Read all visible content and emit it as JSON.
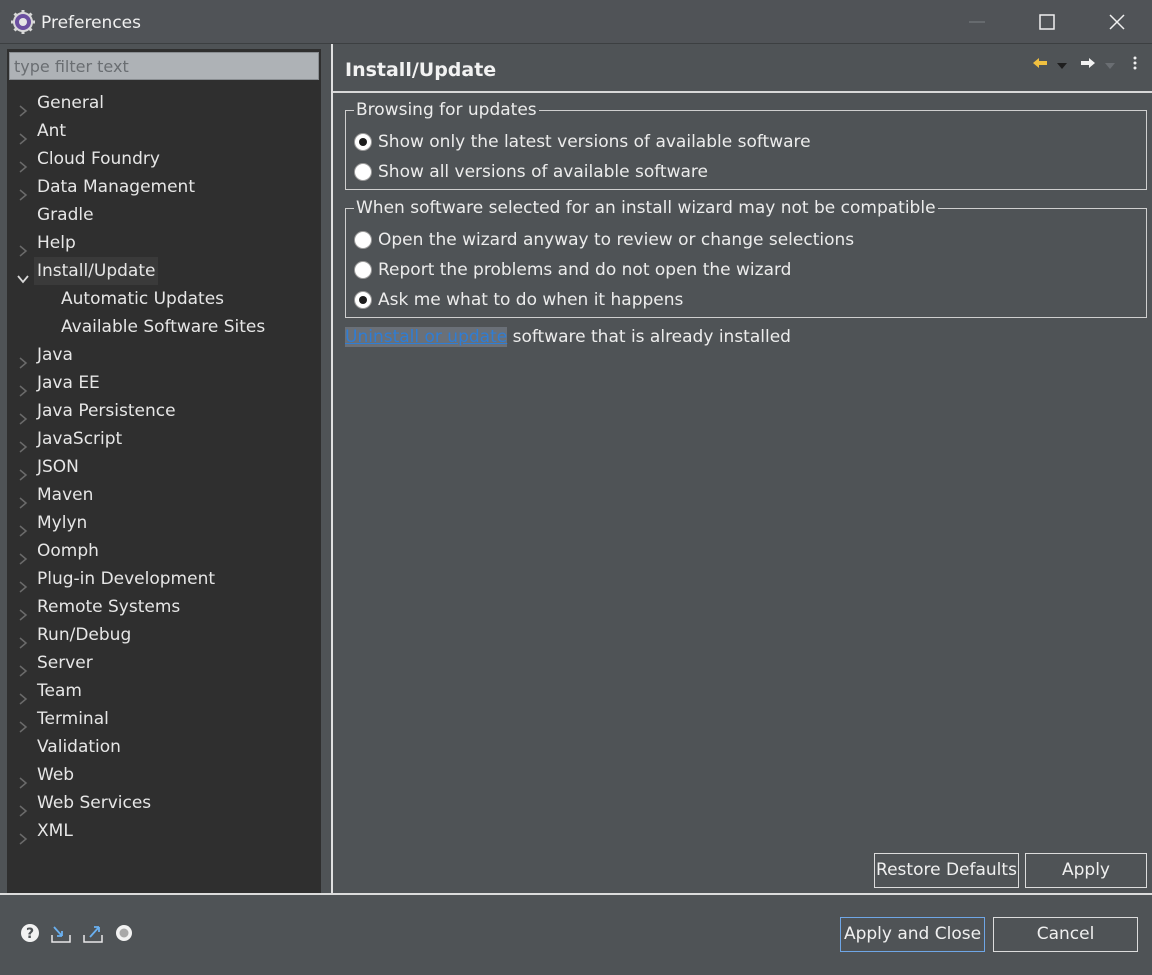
{
  "window": {
    "title": "Preferences"
  },
  "filter": {
    "placeholder": "type filter text"
  },
  "tree": {
    "items": [
      {
        "label": "General",
        "expandable": true
      },
      {
        "label": "Ant",
        "expandable": true
      },
      {
        "label": "Cloud Foundry",
        "expandable": true
      },
      {
        "label": "Data Management",
        "expandable": true
      },
      {
        "label": "Gradle",
        "expandable": false
      },
      {
        "label": "Help",
        "expandable": true
      },
      {
        "label": "Install/Update",
        "expandable": true,
        "expanded": true,
        "selected": true
      },
      {
        "label": "Automatic Updates",
        "child": true
      },
      {
        "label": "Available Software Sites",
        "child": true
      },
      {
        "label": "Java",
        "expandable": true
      },
      {
        "label": "Java EE",
        "expandable": true
      },
      {
        "label": "Java Persistence",
        "expandable": true
      },
      {
        "label": "JavaScript",
        "expandable": true
      },
      {
        "label": "JSON",
        "expandable": true
      },
      {
        "label": "Maven",
        "expandable": true
      },
      {
        "label": "Mylyn",
        "expandable": true
      },
      {
        "label": "Oomph",
        "expandable": true
      },
      {
        "label": "Plug-in Development",
        "expandable": true
      },
      {
        "label": "Remote Systems",
        "expandable": true
      },
      {
        "label": "Run/Debug",
        "expandable": true
      },
      {
        "label": "Server",
        "expandable": true
      },
      {
        "label": "Team",
        "expandable": true
      },
      {
        "label": "Terminal",
        "expandable": true
      },
      {
        "label": "Validation",
        "expandable": false
      },
      {
        "label": "Web",
        "expandable": true
      },
      {
        "label": "Web Services",
        "expandable": true
      },
      {
        "label": "XML",
        "expandable": true
      }
    ]
  },
  "page": {
    "title": "Install/Update",
    "browsing_group": {
      "legend": "Browsing for updates",
      "options": [
        {
          "label": "Show only the latest versions of available software",
          "checked": true
        },
        {
          "label": "Show all versions of available software",
          "checked": false
        }
      ]
    },
    "compat_group": {
      "legend": "When software selected for an install wizard may not be compatible",
      "options": [
        {
          "label": "Open the wizard anyway to review or change selections",
          "checked": false
        },
        {
          "label": "Report the problems and do not open the wizard",
          "checked": false
        },
        {
          "label": "Ask me what to do when it happens",
          "checked": true
        }
      ]
    },
    "link_text": "Uninstall or update",
    "link_suffix": " software that is already installed"
  },
  "buttons": {
    "restore_defaults": "Restore Defaults",
    "apply": "Apply",
    "apply_and_close": "Apply and Close",
    "cancel": "Cancel"
  },
  "colors": {
    "background": "#4f5356",
    "tree_background": "#2f2f2f",
    "link": "#2f7dd4",
    "nav_back_arrow": "#f0c040"
  }
}
